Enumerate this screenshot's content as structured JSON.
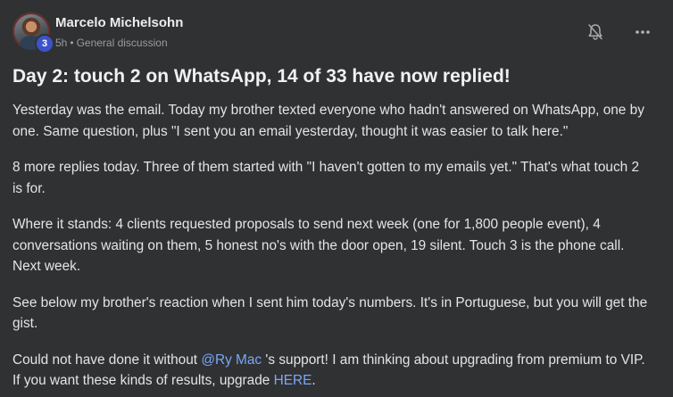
{
  "post": {
    "author": "Marcelo Michelsohn",
    "level": "3",
    "time": "5h",
    "category": "General discussion",
    "title": "Day 2: touch 2 on WhatsApp, 14 of 33 have now replied!",
    "paragraphs": [
      "Yesterday was the email. Today my brother texted everyone who hadn't answered on WhatsApp, one by one. Same question, plus \"I sent you an email yesterday, thought it was easier to talk here.\"",
      "8 more replies today. Three of them started with \"I haven't gotten to my emails yet.\" That's what touch 2 is for.",
      "Where it stands: 4 clients requested proposals to send next week (one for 1,800 people event), 4 conversations waiting on them, 5 honest no's with the door open, 19 silent. Touch 3 is the phone call. Next week.",
      "See below my brother's reaction when I sent him today's numbers. It's in Portuguese, but you will get the gist."
    ],
    "last_paragraph": {
      "before_mention": "Could not have done it without ",
      "mention": "@Ry Mac",
      "after_mention": " 's support! I am thinking about upgrading from premium to VIP. If you want these kinds of results, upgrade ",
      "link_text": "HERE",
      "end": "."
    }
  },
  "icons": {
    "bell": "bell-off-icon",
    "more": "more-horizontal-icon"
  },
  "colors": {
    "background": "#303133",
    "link": "#7aa7f7",
    "badge": "#3c53c9"
  }
}
